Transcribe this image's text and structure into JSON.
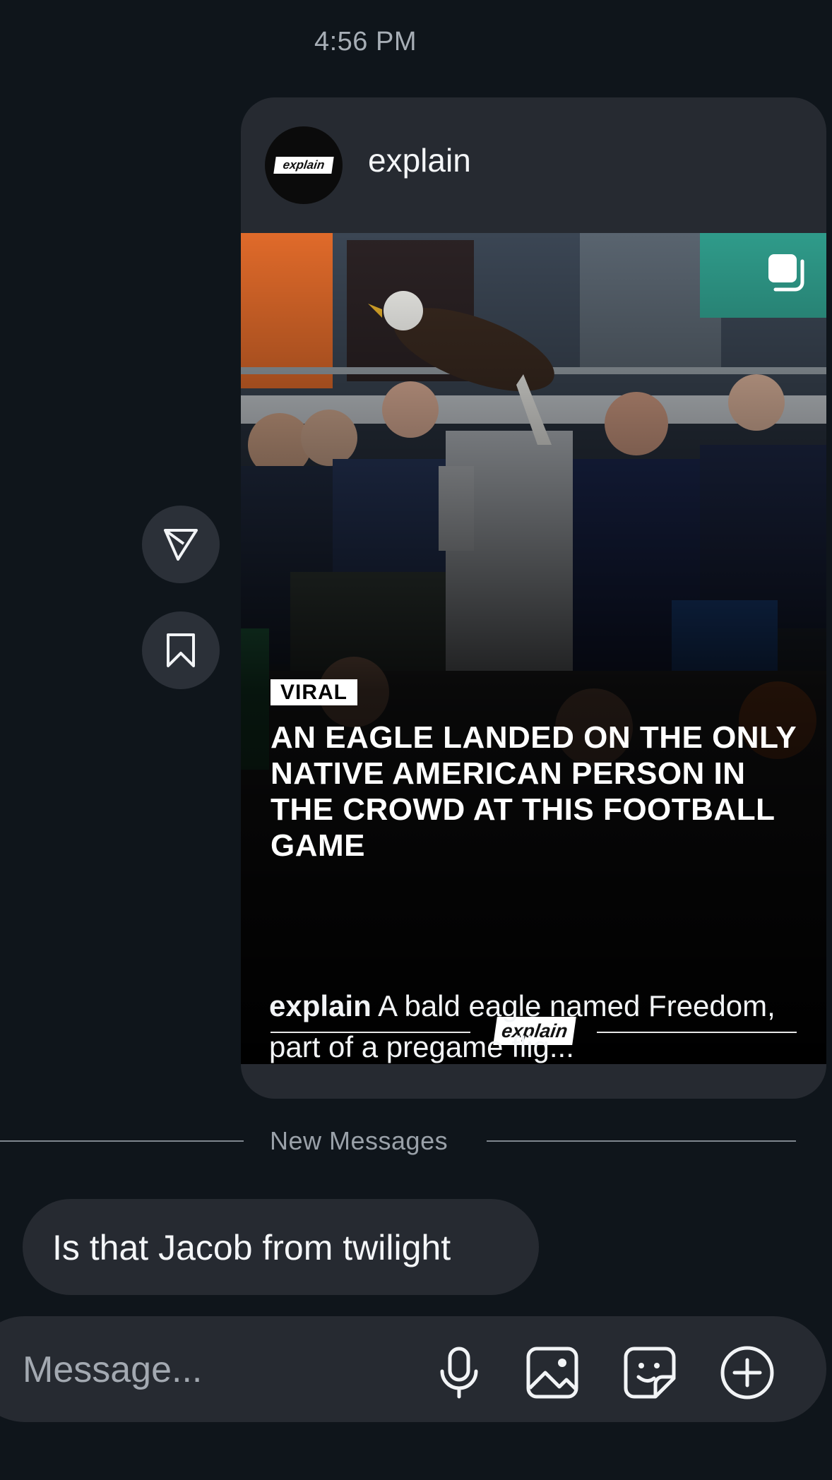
{
  "status": {
    "time": "4:56 PM"
  },
  "post": {
    "author": "explain",
    "avatar_logo": "explain",
    "tag": "VIRAL",
    "headline": "AN EAGLE LANDED ON THE ONLY NATIVE AMERICAN PERSON IN THE CROWD AT THIS FOOTBALL GAME",
    "brand_logo": "explain",
    "caption_author": "explain",
    "caption_text": "A bald eagle named Freedom, part of a pregame flig..."
  },
  "side_actions": {
    "share_icon": "send-icon",
    "save_icon": "bookmark-icon"
  },
  "divider": {
    "label": "New Messages"
  },
  "message": {
    "text": "Is that Jacob from twilight"
  },
  "composer": {
    "placeholder": "Message...",
    "icons": [
      "microphone-icon",
      "photo-icon",
      "sticker-icon",
      "add-icon"
    ]
  },
  "colors": {
    "background": "#0f151b",
    "card": "#262a31",
    "text": "#f2f4f6",
    "muted": "#9aa1a9"
  }
}
